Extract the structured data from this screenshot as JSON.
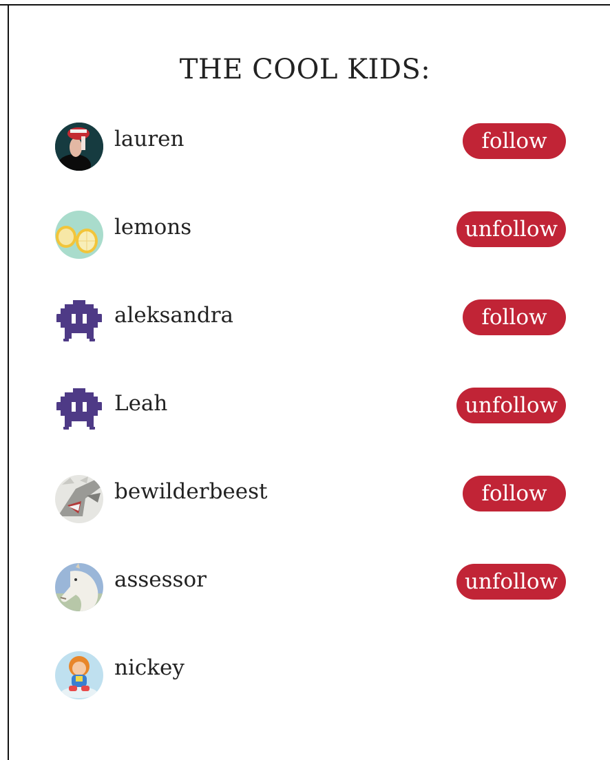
{
  "page": {
    "title": "THE COOL KIDS:"
  },
  "users": [
    {
      "name": "lauren",
      "avatar": "photo-avatar-woman",
      "action": "follow"
    },
    {
      "name": "lemons",
      "avatar": "lemons-avatar",
      "action": "unfollow"
    },
    {
      "name": "aleksandra",
      "avatar": "space-invader-avatar",
      "action": "follow"
    },
    {
      "name": "Leah",
      "avatar": "space-invader-avatar",
      "action": "unfollow"
    },
    {
      "name": "bewilderbeest",
      "avatar": "dragon-avatar",
      "action": "follow"
    },
    {
      "name": "assessor",
      "avatar": "unicorn-avatar",
      "action": "unfollow"
    },
    {
      "name": "nickey",
      "avatar": "doll-avatar",
      "action": ""
    }
  ],
  "colors": {
    "button_background": "#c12436",
    "button_text": "#ffffff",
    "invader_purple": "#4e3a86",
    "text": "#222222"
  }
}
